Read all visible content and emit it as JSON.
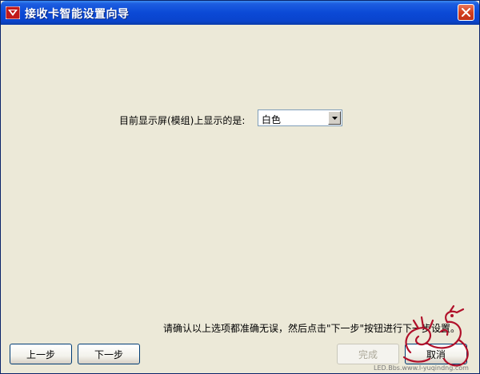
{
  "window": {
    "title": "接收卡智能设置向导",
    "icon": "app-logo-icon",
    "close_icon": "close-icon"
  },
  "form": {
    "question": "目前显示屏(模组)上显示的是:",
    "dropdown": {
      "selected": "白色"
    }
  },
  "hint": "请确认以上选项都准确无误，然后点击\"下一步\"按钮进行下一步设置。",
  "buttons": {
    "prev": "上一步",
    "next": "下一步",
    "finish": "完成",
    "cancel": "取消"
  },
  "watermark": {
    "url": "LED.Bbs.www.l-yuqindng.com"
  },
  "colors": {
    "titlebar": "#0b49d6",
    "close": "#d3401e",
    "window_bg": "#ece9d8",
    "watermark": "#b0102a"
  }
}
